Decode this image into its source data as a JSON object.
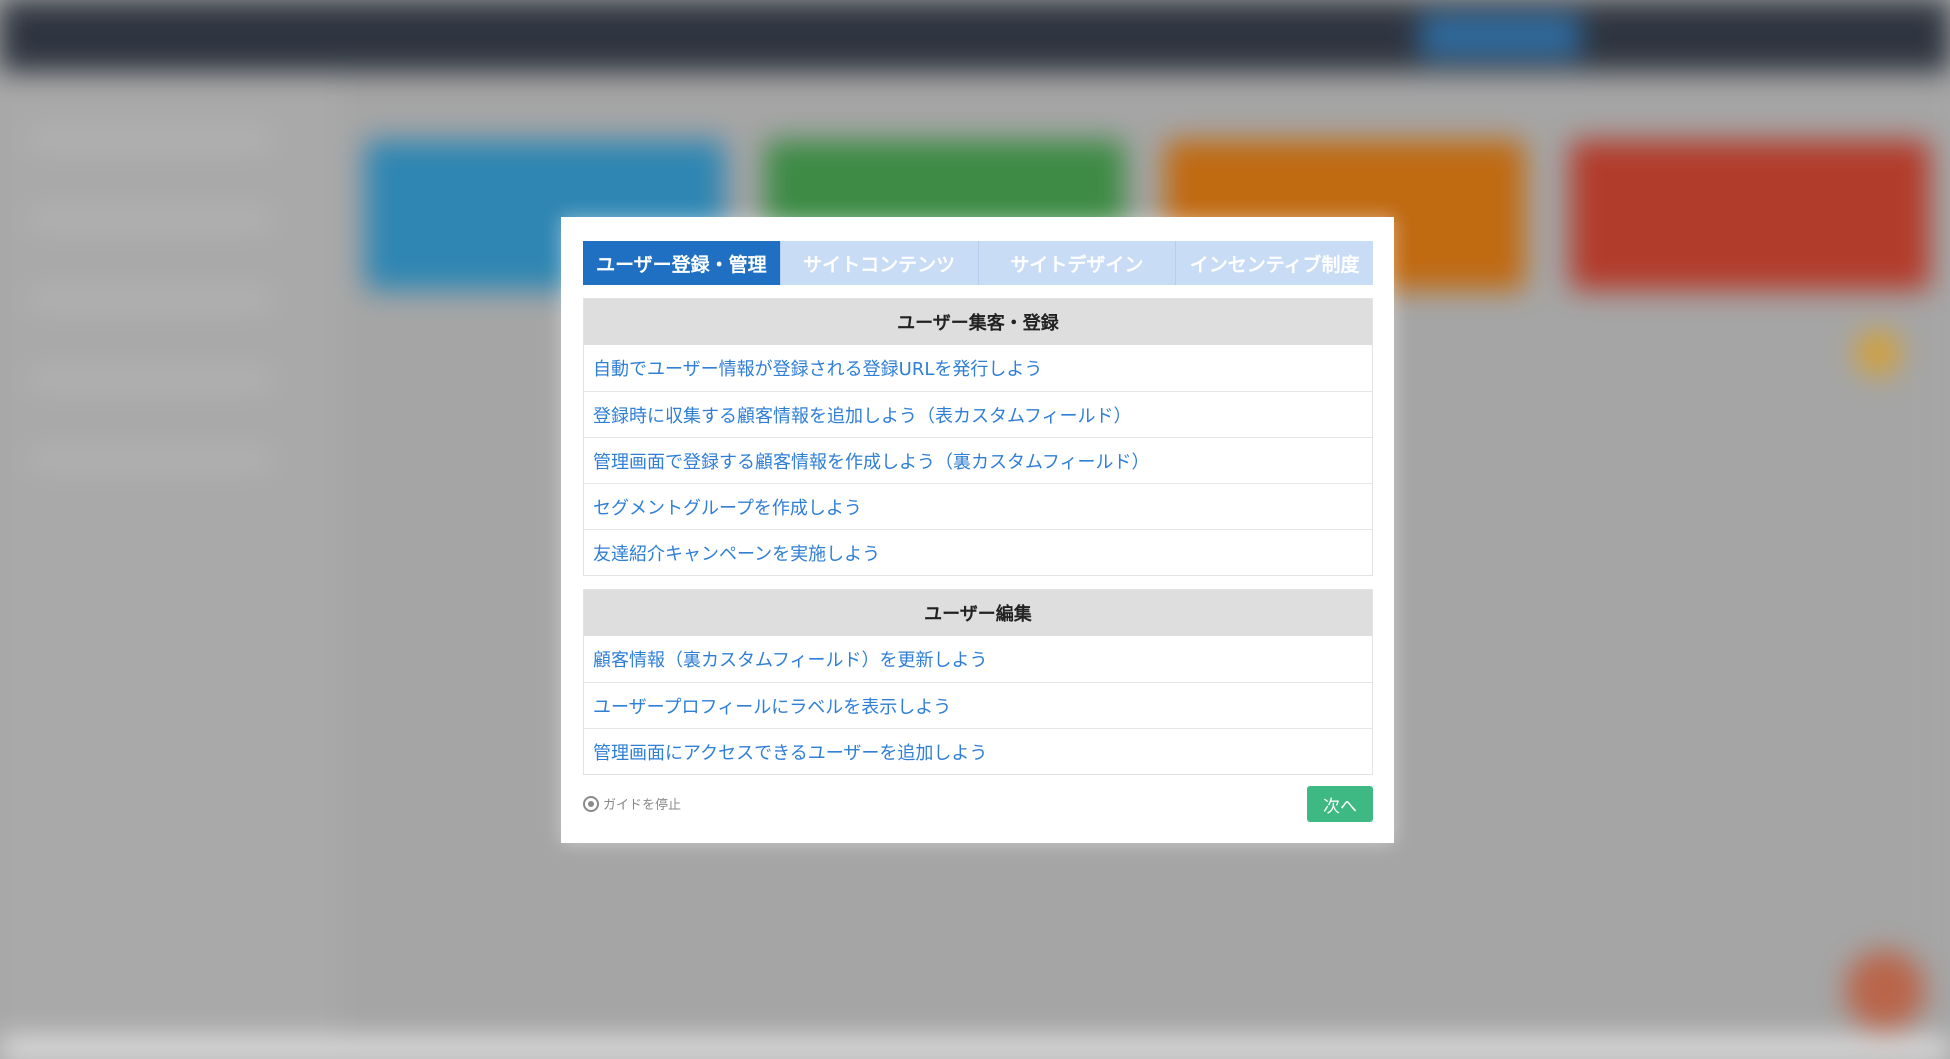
{
  "tabs": [
    {
      "label": "ユーザー登録・管理",
      "active": true
    },
    {
      "label": "サイトコンテンツ",
      "active": false
    },
    {
      "label": "サイトデザイン",
      "active": false
    },
    {
      "label": "インセンティブ制度",
      "active": false
    }
  ],
  "sections": [
    {
      "title": "ユーザー集客・登録",
      "items": [
        "自動でユーザー情報が登録される登録URLを発行しよう",
        "登録時に収集する顧客情報を追加しよう（表カスタムフィールド）",
        "管理画面で登録する顧客情報を作成しよう（裏カスタムフィールド）",
        "セグメントグループを作成しよう",
        "友達紹介キャンペーンを実施しよう"
      ]
    },
    {
      "title": "ユーザー編集",
      "items": [
        "顧客情報（裏カスタムフィールド）を更新しよう",
        "ユーザープロフィールにラベルを表示しよう",
        "管理画面にアクセスできるユーザーを追加しよう"
      ]
    }
  ],
  "footer": {
    "stop_guide_label": "ガイドを停止",
    "next_label": "次へ"
  },
  "colors": {
    "tab_active": "#1f6fc2",
    "tab_inactive": "#c9dcf6",
    "link": "#2f7fd6",
    "next_button": "#3fb984",
    "section_header": "#dedede"
  }
}
